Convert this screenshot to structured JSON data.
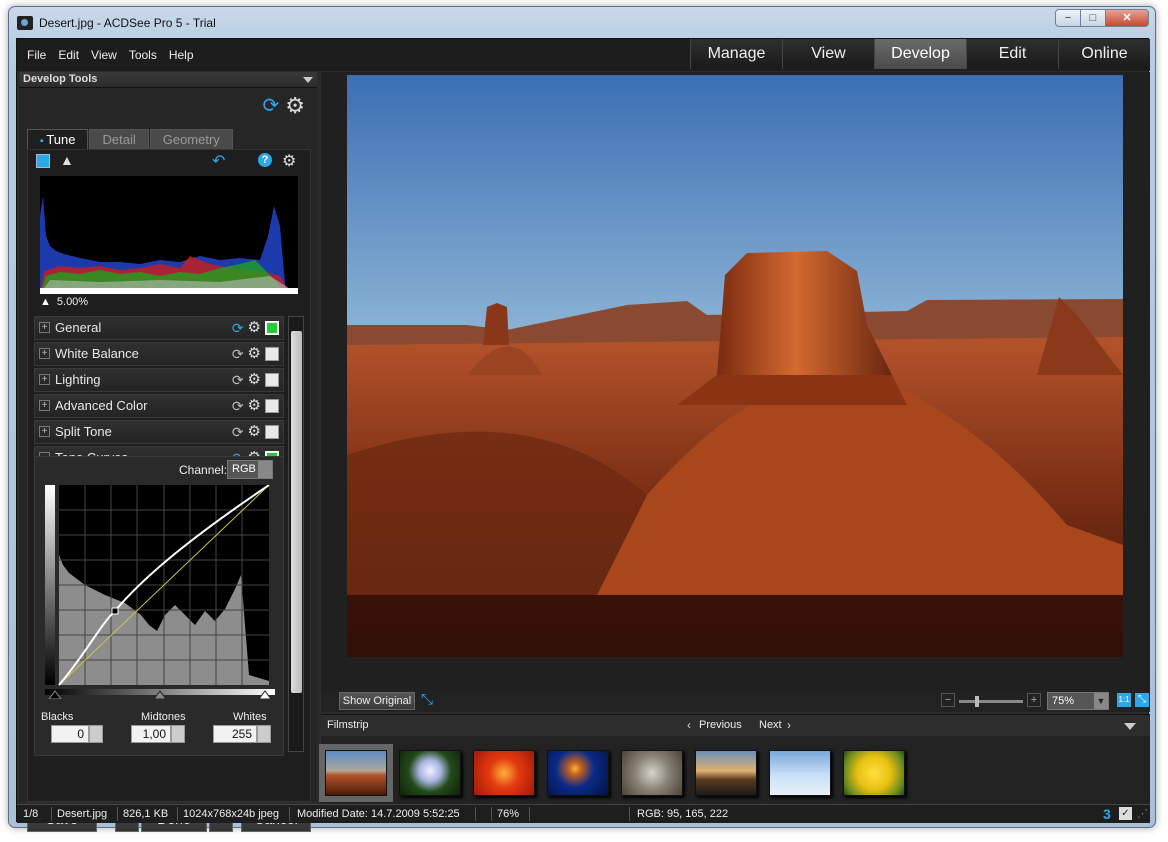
{
  "window": {
    "title": "Desert.jpg - ACDSee Pro 5 - Trial",
    "controls": [
      "−",
      "□",
      "✕"
    ]
  },
  "menu": [
    "File",
    "Edit",
    "View",
    "Tools",
    "Help"
  ],
  "modes": [
    {
      "label": "Manage",
      "active": false
    },
    {
      "label": "View",
      "active": false
    },
    {
      "label": "Develop",
      "active": true
    },
    {
      "label": "Edit",
      "active": false
    },
    {
      "label": "Online",
      "active": false
    }
  ],
  "develop": {
    "header": "Develop Tools",
    "tabs": [
      "Tune",
      "Detail",
      "Geometry"
    ],
    "clip_percent": "5.00%",
    "panels": [
      {
        "label": "General",
        "enabled": true,
        "expanded": false
      },
      {
        "label": "White Balance",
        "enabled": false,
        "expanded": false
      },
      {
        "label": "Lighting",
        "enabled": false,
        "expanded": false
      },
      {
        "label": "Advanced Color",
        "enabled": false,
        "expanded": false
      },
      {
        "label": "Split Tone",
        "enabled": false,
        "expanded": false
      },
      {
        "label": "Tone Curves",
        "enabled": true,
        "expanded": true
      }
    ],
    "tone_curves": {
      "channel_label": "Channel:",
      "channel_value": "RGB",
      "blacks_label": "Blacks",
      "midtones_label": "Midtones",
      "whites_label": "Whites",
      "blacks_value": "0",
      "midtones_value": "1,00",
      "whites_value": "255"
    },
    "buttons": {
      "save": "Save",
      "prev": "<",
      "done": "Done",
      "next": ">",
      "cancel": "Cancel"
    }
  },
  "viewer": {
    "show_original": "Show Original",
    "zoom": "75%",
    "one_to_one": "1:1",
    "zoom_minus": "−",
    "zoom_plus": "+"
  },
  "filmstrip": {
    "label": "Filmstrip",
    "previous": "Previous",
    "next": "Next",
    "count": 8,
    "selected_index": 0
  },
  "status": {
    "index": "1/8",
    "filename": "Desert.jpg",
    "size": "826,1 KB",
    "dimensions": "1024x768x24b jpeg",
    "modified": "Modified Date: 14.7.2009 5:52:25",
    "zoom": "76%",
    "rgb": "RGB: 95, 165, 222"
  },
  "colors": {
    "accent": "#2aa8e8",
    "active_green": "#22cc33"
  }
}
